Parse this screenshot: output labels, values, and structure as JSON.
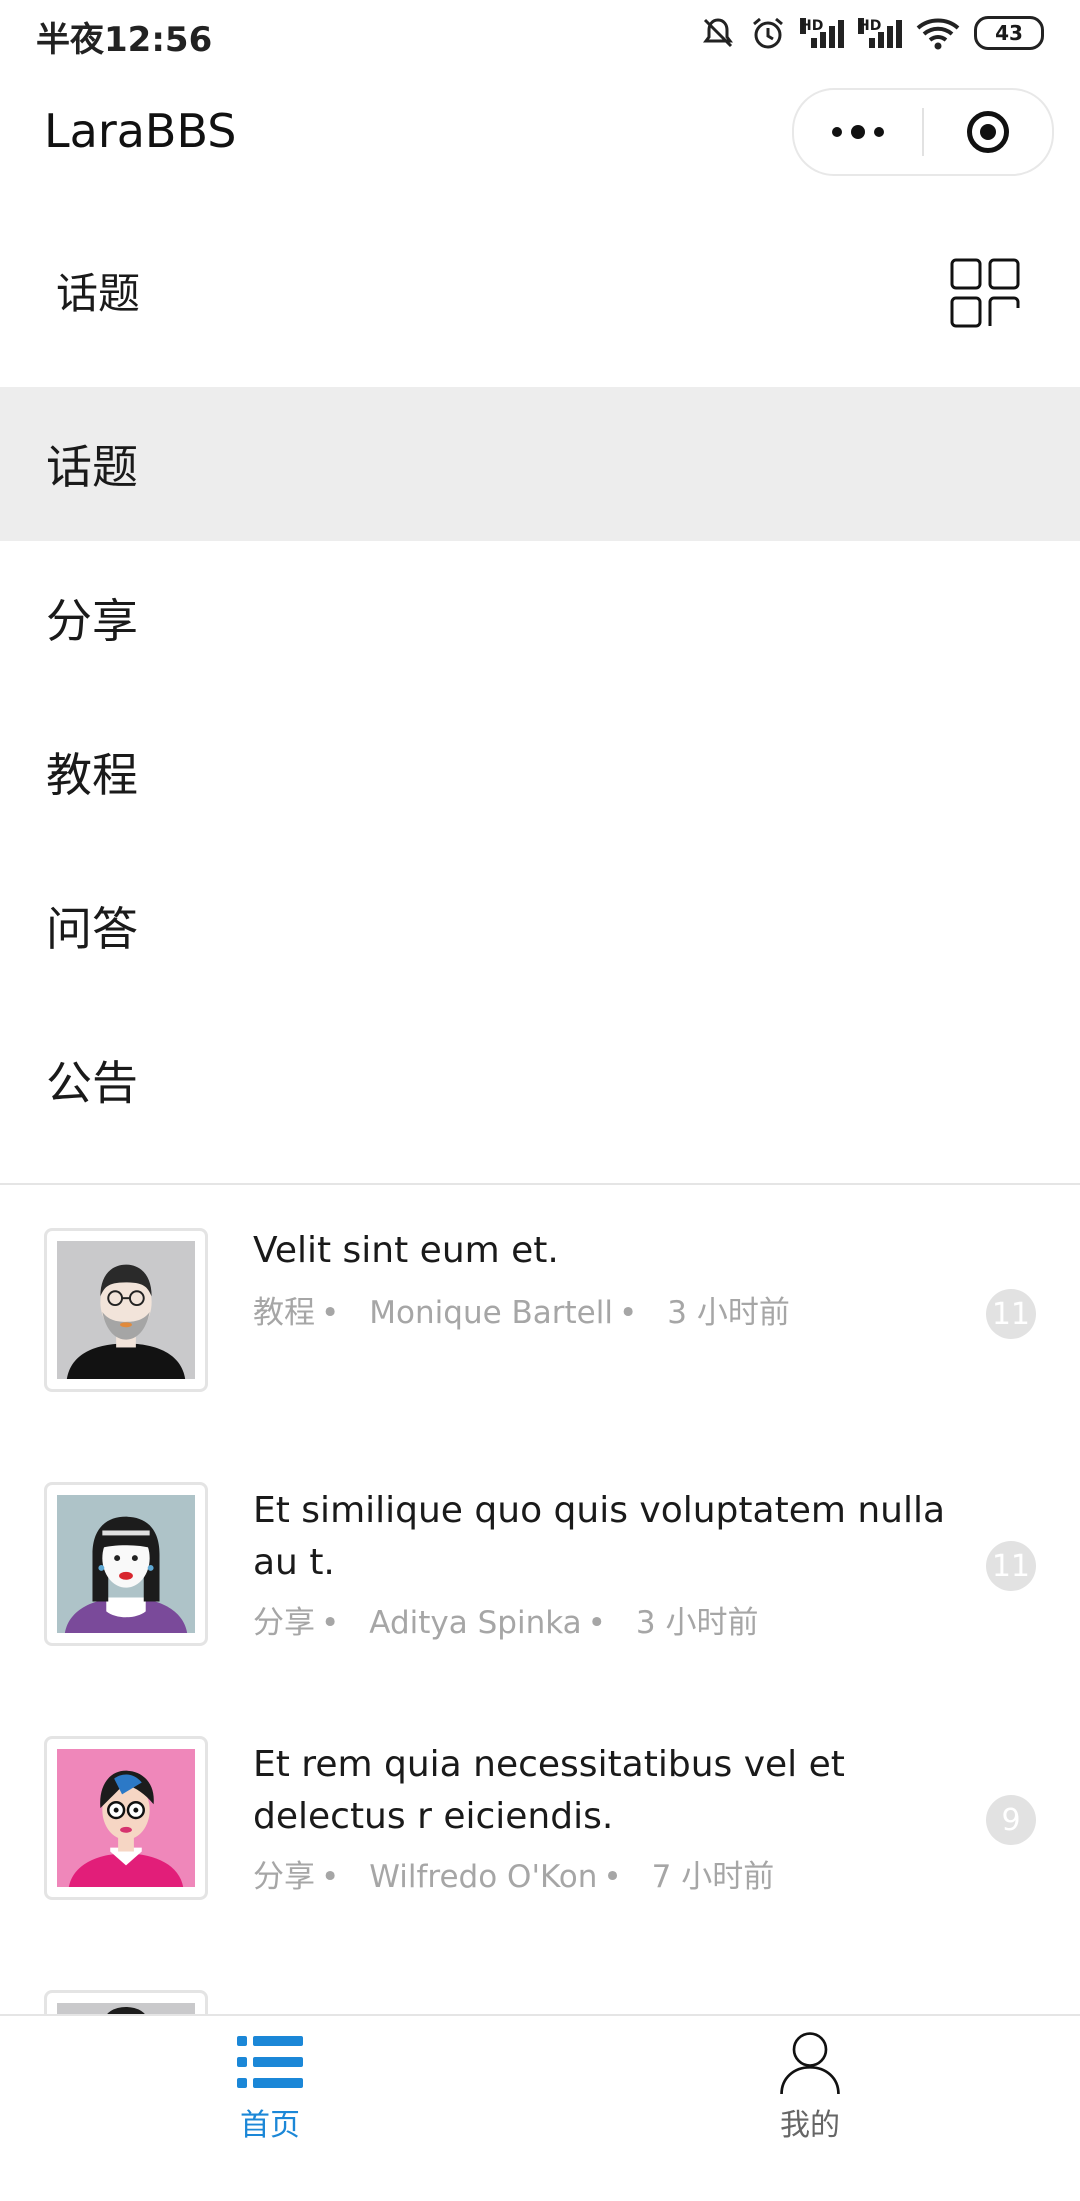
{
  "status_bar": {
    "time": "半夜12:56",
    "battery": "43"
  },
  "nav": {
    "title": "LaraBBS"
  },
  "category": {
    "current": "话题"
  },
  "menu": {
    "items": [
      {
        "label": "话题",
        "active": true
      },
      {
        "label": "分享",
        "active": false
      },
      {
        "label": "教程",
        "active": false
      },
      {
        "label": "问答",
        "active": false
      },
      {
        "label": "公告",
        "active": false
      }
    ]
  },
  "topics": [
    {
      "title": "Velit sint eum et.",
      "category": "教程",
      "author": "Monique Bartell",
      "time": "3 小时前",
      "replies": "11",
      "avatar": "avatar-man-glasses"
    },
    {
      "title": "Et similique quo quis voluptatem nulla au t.",
      "category": "分享",
      "author": "Aditya Spinka",
      "time": "3 小时前",
      "replies": "11",
      "avatar": "avatar-woman-bangs"
    },
    {
      "title": "Et rem quia necessitatibus vel et delectus r eiciendis.",
      "category": "分享",
      "author": "Wilfredo O'Kon",
      "time": "7 小时前",
      "replies": "9",
      "avatar": "avatar-woman-pink"
    }
  ],
  "tabbar": {
    "home": "首页",
    "me": "我的",
    "accent": "#1b87d7"
  }
}
